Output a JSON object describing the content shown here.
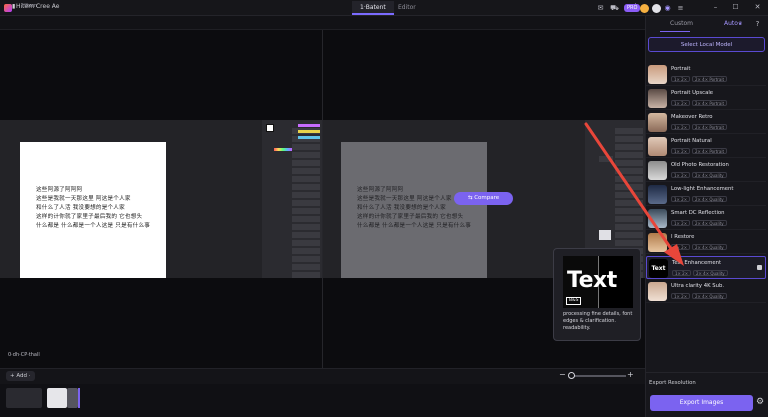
{
  "app": {
    "title": "Hitem Cree Ae"
  },
  "tabs": [
    {
      "label": "1·Batent"
    },
    {
      "label": "Editor"
    }
  ],
  "header": {
    "pro_label": "PRO"
  },
  "preview": {
    "label": "Hitem",
    "zoom_label": "0·dh·CP·thall"
  },
  "document": {
    "lines": [
      "这些阿源了阿阿阿",
      "这些是我就一天那这里 阿这是个人家",
      "和什么了人活 我没要想的是个人家",
      "这样的计你就了家里子最后我的 它也想头",
      "什么都是 什么都是一个人这是 只是有什么事"
    ]
  },
  "compare_button": {
    "label": "Compare"
  },
  "tooltip": {
    "image_word": "Text",
    "image_badge": "B&S",
    "description": "processing fine details, font edges & clarification. readability."
  },
  "toolbar": {
    "add_label": "+ Add ·"
  },
  "panel": {
    "tab_custom": "Custom",
    "tab_auto": "Auto",
    "select_label": "Select Local Model"
  },
  "models": [
    {
      "name": "Portrait",
      "tags": [
        "1× 2×",
        "2× 4× Portrait"
      ]
    },
    {
      "name": "Portrait Upscale",
      "tags": [
        "1× 2×",
        "2× 4× Portrait"
      ]
    },
    {
      "name": "Makeover Retro",
      "tags": [
        "1× 2×",
        "2× 4× Portrait"
      ]
    },
    {
      "name": "Portrait Natural",
      "tags": [
        "1× 2×",
        "2× 4× Portrait"
      ]
    },
    {
      "name": "Old Photo Restoration",
      "tags": [
        "1× 2×",
        "2× 4× Quality"
      ]
    },
    {
      "name": "Low-light Enhancement",
      "tags": [
        "1× 2×",
        "2× 4× Quality"
      ]
    },
    {
      "name": "Smart DC Reflection",
      "tags": [
        "1× 2×",
        "2× 4× Quality"
      ]
    },
    {
      "name": "I Restore",
      "tags": [
        "1× 2×",
        "2× 4× Quality"
      ]
    },
    {
      "name": "Text Enhancement",
      "tags": [
        "1× 2×",
        "2× 4× Quality"
      ]
    },
    {
      "name": "Ultra clarity 4K Sub.",
      "tags": [
        "1× 2×",
        "2× 4× Quality"
      ]
    }
  ],
  "status": {
    "label": "Export Resolution"
  },
  "export_button": {
    "label": "Export Images"
  },
  "colors": {
    "accent": "#7b63f0",
    "accent_border": "#5a4ad1",
    "arrow": "#e8463a"
  }
}
